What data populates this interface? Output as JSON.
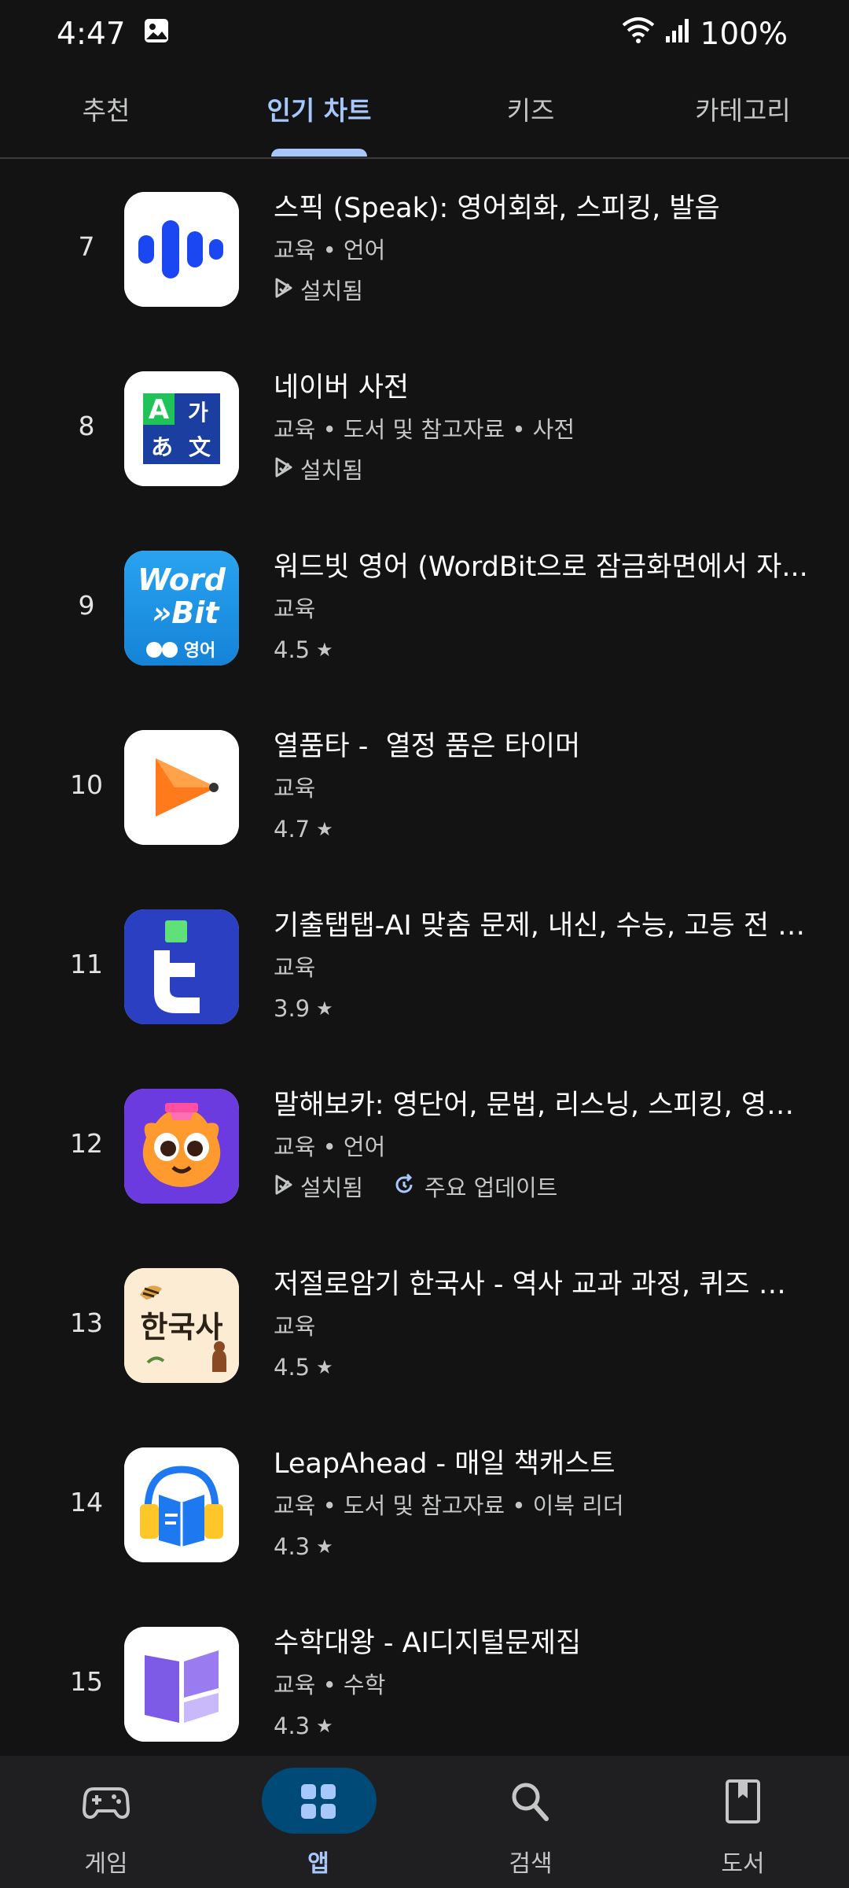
{
  "status_bar": {
    "time": "4:47",
    "battery": "100%",
    "icons": [
      "image-icon",
      "wifi-icon",
      "signal-icon"
    ]
  },
  "tabs": [
    {
      "label": "추천",
      "active": false
    },
    {
      "label": "인기 차트",
      "active": true
    },
    {
      "label": "키즈",
      "active": false
    },
    {
      "label": "카테고리",
      "active": false
    }
  ],
  "apps": [
    {
      "rank": "7",
      "title": "스픽 (Speak): 영어회화, 스피킹, 발음",
      "meta": "교육 • 언어",
      "status": "설치됨",
      "icon": "speak-app-icon"
    },
    {
      "rank": "8",
      "title": "네이버 사전",
      "meta": "교육 • 도서 및 참고자료 • 사전",
      "status": "설치됨",
      "icon": "naver-dictionary-app-icon",
      "icon_text": [
        "A",
        "가",
        "あ",
        "文"
      ]
    },
    {
      "rank": "9",
      "title": "워드빗 영어 (WordBit으로 잠금화면에서 자...",
      "meta": "교육",
      "rating": "4.5",
      "icon": "wordbit-app-icon",
      "icon_text": [
        "Word",
        "»Bit",
        "영어"
      ]
    },
    {
      "rank": "10",
      "title": "열품타 -  열정 품은 타이머",
      "meta": "교육",
      "rating": "4.7",
      "icon": "yeolpumta-app-icon"
    },
    {
      "rank": "11",
      "title": "기출탭탭-AI 맞춤 문제, 내신, 수능, 고등 전 과목",
      "meta": "교육",
      "rating": "3.9",
      "icon": "tabtab-app-icon"
    },
    {
      "rank": "12",
      "title": "말해보카: 영단어, 문법, 리스닝, 스피킹, 영어 ...",
      "meta": "교육 • 언어",
      "status": "설치됨",
      "update": "주요 업데이트",
      "icon": "malhaevoca-app-icon"
    },
    {
      "rank": "13",
      "title": "저절로암기 한국사 - 역사 교과 과정, 퀴즈 알람",
      "meta": "교육",
      "rating": "4.5",
      "icon": "korean-history-app-icon",
      "icon_text": [
        "한국사"
      ]
    },
    {
      "rank": "14",
      "title": "LeapAhead - 매일 책캐스트",
      "meta": "교육 • 도서 및 참고자료 • 이북 리더",
      "rating": "4.3",
      "icon": "leapahead-app-icon"
    },
    {
      "rank": "15",
      "title": "수학대왕 - AI디지털문제집",
      "meta": "교육 • 수학",
      "rating": "4.3",
      "icon": "math-king-app-icon"
    }
  ],
  "bottom_nav": [
    {
      "label": "게임",
      "icon": "gamepad-icon",
      "active": false
    },
    {
      "label": "앱",
      "icon": "apps-grid-icon",
      "active": true
    },
    {
      "label": "검색",
      "icon": "search-icon",
      "active": false
    },
    {
      "label": "도서",
      "icon": "book-icon",
      "active": false
    }
  ],
  "colors": {
    "background": "#131314",
    "accent": "#a8c7fa",
    "nav_pill": "#004a77"
  }
}
